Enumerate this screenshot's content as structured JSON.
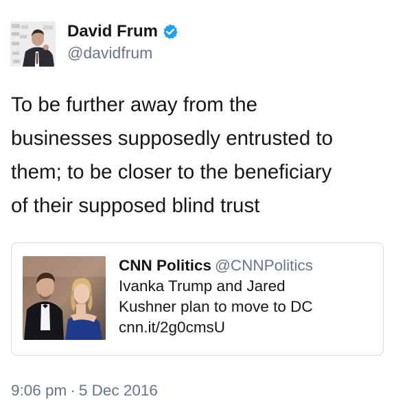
{
  "author": {
    "display_name": "David Frum",
    "handle": "@davidfrum",
    "verified": true,
    "avatar_icon": "profile-photo"
  },
  "tweet": {
    "text_lines": [
      "To be further away from the",
      "businesses supposedly entrusted to",
      "them; to be closer to the beneficiary",
      "of their supposed blind trust"
    ]
  },
  "quoted": {
    "display_name": "CNN Politics",
    "handle": "@CNNPolitics",
    "text_lines": [
      "Ivanka Trump and Jared",
      "Kushner plan to move to DC",
      "cnn.it/2g0cmsU"
    ],
    "image_icon": "couple-photo"
  },
  "meta": {
    "time": "9:06 pm",
    "separator": "·",
    "date": "5 Dec 2016"
  },
  "colors": {
    "verified_badge": "#1da1f2",
    "secondary_text": "#657786",
    "primary_text": "#14171a",
    "card_border": "#d3dbe2"
  }
}
